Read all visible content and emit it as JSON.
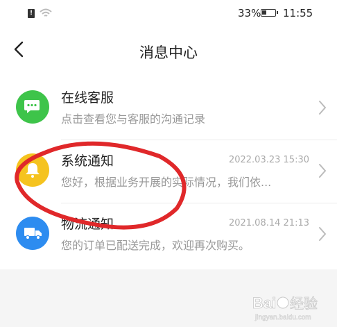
{
  "status_bar": {
    "sim_glyph": "!",
    "battery_percent": "33%",
    "time": "11:55"
  },
  "header": {
    "title": "消息中心",
    "back_icon": "chevron-left-icon"
  },
  "messages": [
    {
      "title": "在线客服",
      "description": "点击查看您与客服的沟通记录",
      "time": "",
      "icon": "chat-bubble-icon",
      "color": "#3ec44a"
    },
    {
      "title": "系统通知",
      "description": "您好，根据业务开展的实际情况，我们依...",
      "time": "2022.03.23  15:30",
      "icon": "bell-icon",
      "color": "#f5c31f"
    },
    {
      "title": "物流通知",
      "description": "您的订单已配送完成，欢迎再次购买。",
      "time": "2021.08.14  21:13",
      "icon": "truck-icon",
      "color": "#2d8cf0"
    }
  ],
  "annotation": {
    "color": "#e0282a"
  },
  "watermark": {
    "brand": "Baidu",
    "text": "经验",
    "url": "jingyan.baidu.com"
  }
}
